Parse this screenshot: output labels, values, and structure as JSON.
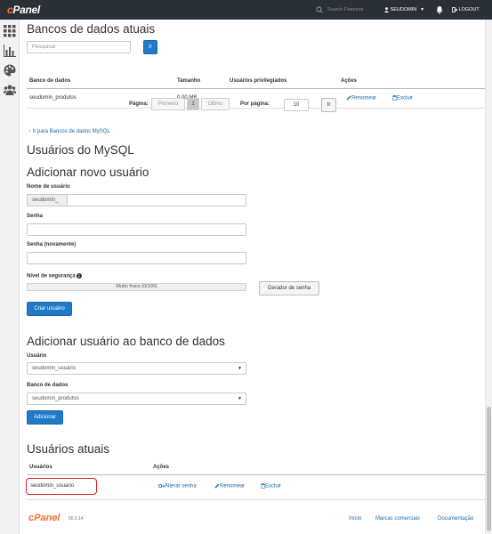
{
  "topbar": {
    "logo_prefix": "c",
    "logo_main": "Panel",
    "search_placeholder": "Search Features",
    "user": "SEUDOMIN",
    "logout": "LOGOUT"
  },
  "sidebar": {
    "items": [
      {
        "icon": "grid-icon"
      },
      {
        "icon": "bar-chart-icon"
      },
      {
        "icon": "palette-icon"
      },
      {
        "icon": "users-icon"
      }
    ]
  },
  "databases": {
    "title": "Bancos de dados atuais",
    "search_placeholder": "Pesquisar",
    "search_button": "Ir",
    "columns": [
      "Banco de dados",
      "Tamanho",
      "Usuários privilegiados",
      "Ações"
    ],
    "rows": [
      {
        "name": "seudomin_produtos",
        "size": "0.00 MB",
        "users": "",
        "rename": "Renomear",
        "delete": "Excluir"
      }
    ],
    "pager": {
      "page_label": "Página:",
      "first": "Primeiro",
      "current": "1",
      "last": "Último",
      "per_page_label": "Por página:",
      "per_page_value": "10",
      "go": "Ir"
    },
    "goto_link": "Ir para Bancos de dados MySQL"
  },
  "mysql_users": {
    "title": "Usuários do MySQL",
    "add_title": "Adicionar novo usuário",
    "username_label": "Nome de usuário",
    "username_prefix": "seudomin_",
    "username_value": "",
    "password_label": "Senha",
    "password_again_label": "Senha (novamente)",
    "strength_label": "Nível de segurança",
    "strength_value": "Muito fraco (0/100)",
    "generator_button": "Gerador de senha",
    "create_button": "Criar usuário"
  },
  "add_to_db": {
    "title": "Adicionar usuário ao banco de dados",
    "user_label": "Usuário",
    "user_selected": "seudomin_usuario",
    "db_label": "Banco de dados",
    "db_selected": "seudomin_produtos",
    "add_button": "Adicionar"
  },
  "current_users": {
    "title": "Usuários atuais",
    "columns": [
      "Usuários",
      "Ações"
    ],
    "rows": [
      {
        "name": "seudomin_usuario",
        "change_password": "Alterar senha",
        "rename": "Renomear",
        "delete": "Excluir"
      }
    ]
  },
  "footer": {
    "logo_prefix": "c",
    "logo_main": "Panel",
    "version": "56.0.14",
    "links": [
      "Início",
      "Marcas comerciais",
      "Documentação"
    ]
  },
  "colors": {
    "topbar": "#2b2f36",
    "accent": "#1f7ac8",
    "link": "#1a6aa8",
    "highlight": "#e02020",
    "logo_orange": "#ff6c2c"
  }
}
